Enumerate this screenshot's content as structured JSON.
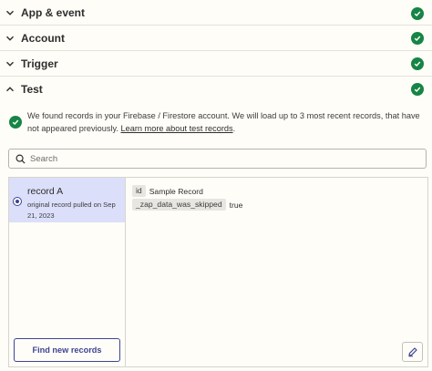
{
  "sections": [
    {
      "title": "App & event",
      "expanded": false,
      "complete": true
    },
    {
      "title": "Account",
      "expanded": false,
      "complete": true
    },
    {
      "title": "Trigger",
      "expanded": false,
      "complete": true
    },
    {
      "title": "Test",
      "expanded": true,
      "complete": true
    }
  ],
  "notice": {
    "text": "We found records in your Firebase / Firestore account. We will load up to 3 most recent records, that have not appeared previously. ",
    "link": "Learn more about test records",
    "suffix": "."
  },
  "search": {
    "placeholder": "Search",
    "value": ""
  },
  "records": [
    {
      "name": "record A",
      "subtitle": "original record pulled on Sep 21, 2023",
      "selected": true
    }
  ],
  "find_button": "Find new records",
  "record_fields": [
    {
      "key": "id",
      "value": "Sample Record"
    },
    {
      "key": "_zap_data_was_skipped",
      "value": "true"
    }
  ],
  "colors": {
    "success": "#168545",
    "accent": "#3d4592",
    "selected_bg": "#dcdffa"
  }
}
